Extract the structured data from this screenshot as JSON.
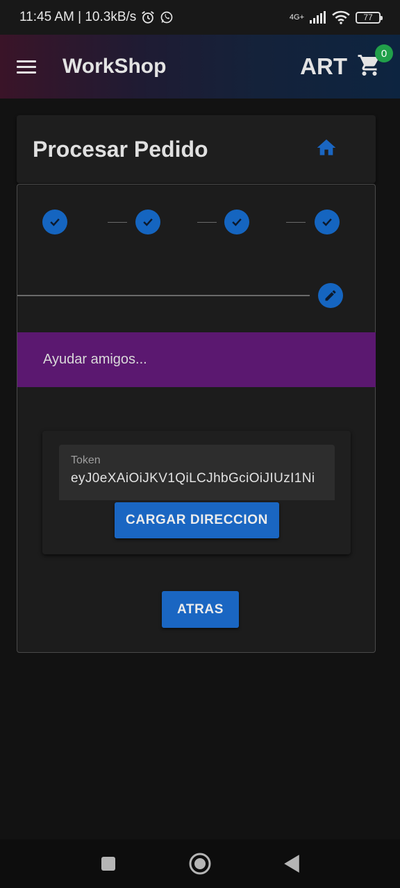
{
  "status_bar": {
    "time_info": "11:45 AM | 10.3kB/s",
    "network": "4G+",
    "battery": "77",
    "icons": [
      "alarm-icon",
      "whatsapp-icon",
      "signal-icon",
      "wifi-icon",
      "battery-icon"
    ]
  },
  "app_bar": {
    "title": "WorkShop",
    "right_label": "ART",
    "cart_count": "0",
    "icons": [
      "menu-icon",
      "cart-icon"
    ]
  },
  "header": {
    "title": "Procesar Pedido",
    "icon": "home-icon"
  },
  "stepper": {
    "completed_steps": 4,
    "active_step_icon": "edit-icon",
    "active_step_content": "Ayudar amigos...",
    "token": {
      "label": "Token",
      "value": "eyJ0eXAiOiJKV1QiLCJhbGciOiJIUzI1Ni"
    },
    "load_button": "CARGAR DIRECCION",
    "back_button": "ATRAS"
  },
  "colors": {
    "accent": "#1565c0",
    "step_content_bg": "#5b1870",
    "badge": "#21a04a"
  },
  "nav_bar": {
    "icons": [
      "recent-apps-icon",
      "home-nav-icon",
      "back-nav-icon"
    ]
  }
}
